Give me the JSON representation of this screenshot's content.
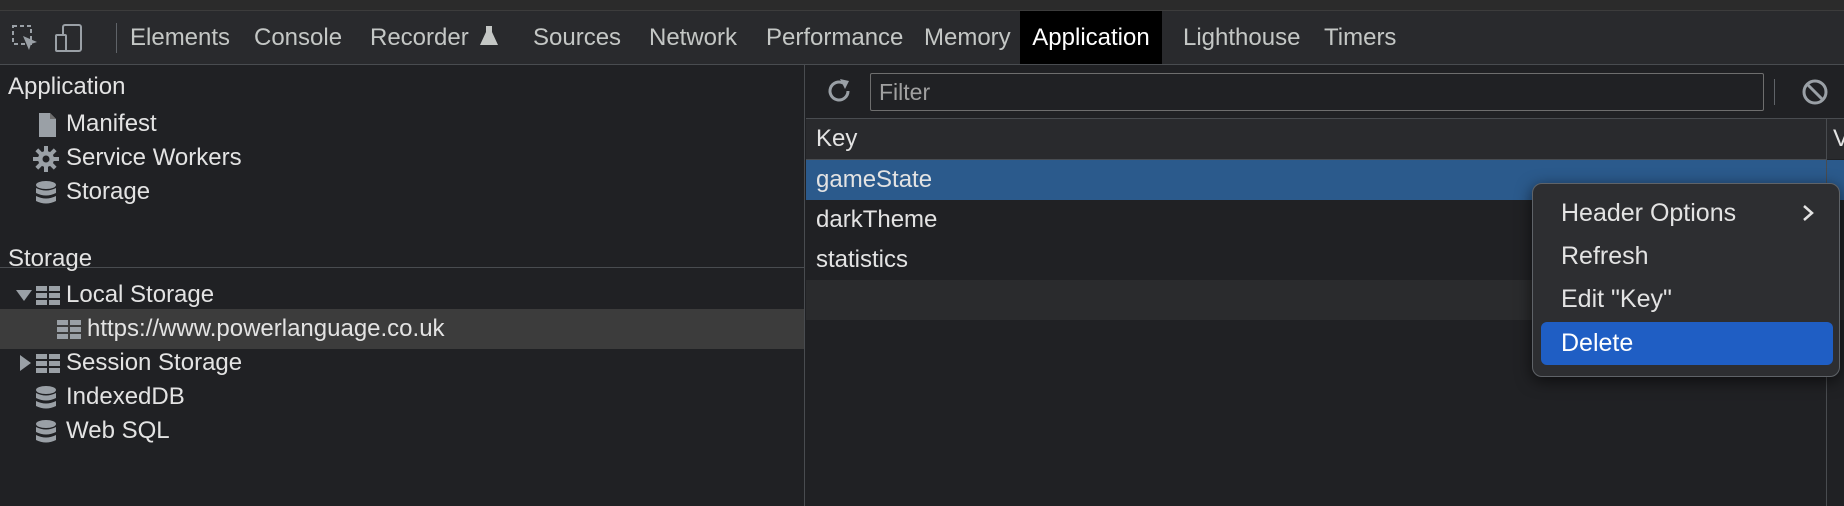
{
  "tabs": [
    {
      "label": "Elements"
    },
    {
      "label": "Console"
    },
    {
      "label": "Recorder"
    },
    {
      "label": "Sources"
    },
    {
      "label": "Network"
    },
    {
      "label": "Performance"
    },
    {
      "label": "Memory"
    },
    {
      "label": "Application",
      "active": true
    },
    {
      "label": "Lighthouse"
    },
    {
      "label": "Timers"
    }
  ],
  "sidebar": {
    "application_title": "Application",
    "application_items": [
      {
        "label": "Manifest",
        "icon": "document-icon"
      },
      {
        "label": "Service Workers",
        "icon": "gear-icon"
      },
      {
        "label": "Storage",
        "icon": "database-icon"
      }
    ],
    "storage_title": "Storage",
    "storage_items": [
      {
        "label": "Local Storage",
        "icon": "table-icon",
        "expanded": true
      },
      {
        "label": "https://www.powerlanguage.co.uk",
        "icon": "table-icon",
        "selected": true
      },
      {
        "label": "Session Storage",
        "icon": "table-icon",
        "expanded": false
      },
      {
        "label": "IndexedDB",
        "icon": "database-icon"
      },
      {
        "label": "Web SQL",
        "icon": "database-icon"
      }
    ]
  },
  "filter": {
    "placeholder": "Filter",
    "value": ""
  },
  "table": {
    "columns": {
      "key": "Key",
      "value": "V"
    },
    "rows": [
      {
        "key": "gameState",
        "selected": true
      },
      {
        "key": "darkTheme"
      },
      {
        "key": "statistics"
      }
    ]
  },
  "context_menu": {
    "items": [
      {
        "label": "Header Options",
        "submenu": true
      },
      {
        "label": "Refresh"
      },
      {
        "label": "Edit \"Key\""
      },
      {
        "label": "Delete",
        "highlighted": true
      }
    ]
  },
  "colors": {
    "background": "#202124",
    "selection": "#2b5a8c",
    "menu_highlight": "#1f5ec4",
    "active_tab": "#000000"
  }
}
